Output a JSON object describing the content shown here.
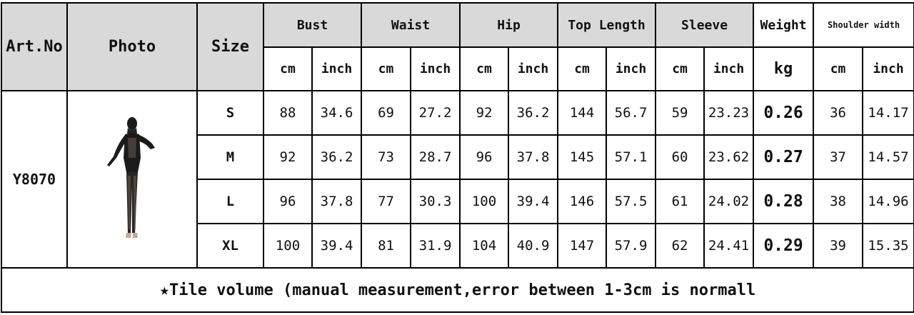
{
  "headers": {
    "art_no": "Art.No",
    "photo": "Photo",
    "size": "Size",
    "bust": "Bust",
    "waist": "Waist",
    "hip": "Hip",
    "top_length": "Top Length",
    "sleeve": "Sleeve",
    "weight": "Weight",
    "shoulder_width": "Shoulder width"
  },
  "units": {
    "cm": "cm",
    "inch": "inch",
    "kg": "kg"
  },
  "product": {
    "art_no": "Y8070",
    "photo_desc": "black-sheer-jumpsuit"
  },
  "rows": [
    {
      "size": "S",
      "bust_cm": "88",
      "bust_in": "34.6",
      "waist_cm": "69",
      "waist_in": "27.2",
      "hip_cm": "92",
      "hip_in": "36.2",
      "len_cm": "144",
      "len_in": "56.7",
      "sleeve_cm": "59",
      "sleeve_in": "23.23",
      "weight": "0.26",
      "shoulder_cm": "36",
      "shoulder_in": "14.17"
    },
    {
      "size": "M",
      "bust_cm": "92",
      "bust_in": "36.2",
      "waist_cm": "73",
      "waist_in": "28.7",
      "hip_cm": "96",
      "hip_in": "37.8",
      "len_cm": "145",
      "len_in": "57.1",
      "sleeve_cm": "60",
      "sleeve_in": "23.62",
      "weight": "0.27",
      "shoulder_cm": "37",
      "shoulder_in": "14.57"
    },
    {
      "size": "L",
      "bust_cm": "96",
      "bust_in": "37.8",
      "waist_cm": "77",
      "waist_in": "30.3",
      "hip_cm": "100",
      "hip_in": "39.4",
      "len_cm": "146",
      "len_in": "57.5",
      "sleeve_cm": "61",
      "sleeve_in": "24.02",
      "weight": "0.28",
      "shoulder_cm": "38",
      "shoulder_in": "14.96"
    },
    {
      "size": "XL",
      "bust_cm": "100",
      "bust_in": "39.4",
      "waist_cm": "81",
      "waist_in": "31.9",
      "hip_cm": "104",
      "hip_in": "40.9",
      "len_cm": "147",
      "len_in": "57.9",
      "sleeve_cm": "62",
      "sleeve_in": "24.41",
      "weight": "0.29",
      "shoulder_cm": "39",
      "shoulder_in": "15.35"
    }
  ],
  "footnote": "★Tile volume (manual measurement,error between 1-3cm is normall"
}
